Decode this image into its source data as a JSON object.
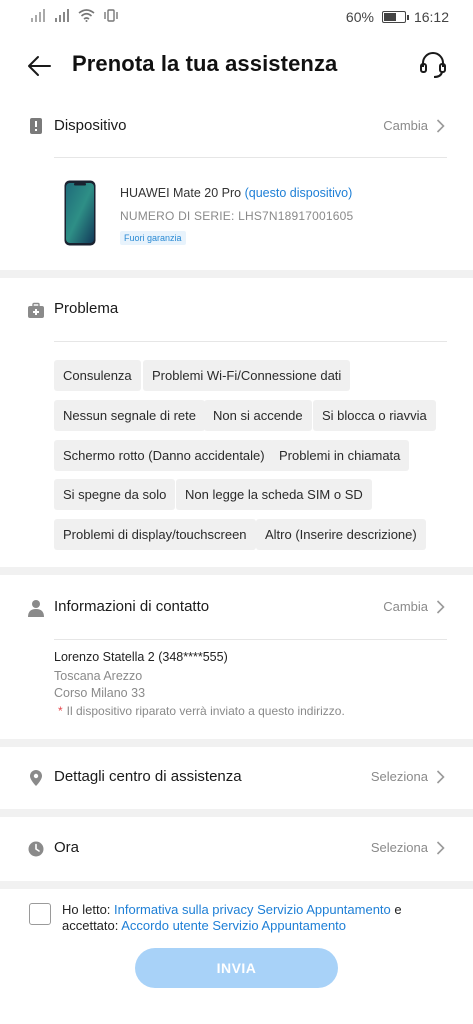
{
  "status": {
    "battery": "60%",
    "battery_level": 0.6,
    "time": "16:12"
  },
  "header": {
    "title": "Prenota la tua assistenza"
  },
  "device": {
    "title": "Dispositivo",
    "action": "Cambia",
    "name": "HUAWEI Mate 20 Pro",
    "this_device": "(questo dispositivo)",
    "serial": "NUMERO DI SERIE: LHS7N18917001605",
    "warranty": "Fuori garanzia"
  },
  "problem": {
    "title": "Problema",
    "options": [
      "Consulenza",
      "Problemi Wi-Fi/Connessione dati",
      "Nessun segnale di rete",
      "Non si accende",
      "Si blocca o riavvia",
      "Schermo rotto (Danno accidentale)",
      "Problemi in chiamata",
      "Si spegne da solo",
      "Non legge la scheda SIM o SD",
      "Problemi di display/touchscreen",
      "Altro (Inserire descrizione)"
    ]
  },
  "contact": {
    "title": "Informazioni di contatto",
    "action": "Cambia",
    "name_phone": "Lorenzo Statella 2 (348****555)",
    "region": "Toscana Arezzo",
    "street": "Corso Milano 33",
    "note": "Il dispositivo riparato verrà inviato a questo indirizzo."
  },
  "service_center": {
    "title": "Dettagli centro di assistenza",
    "action": "Seleziona"
  },
  "time_slot": {
    "title": "Ora",
    "action": "Seleziona"
  },
  "consent": {
    "prefix": "Ho letto: ",
    "privacy_link": "Informativa sulla privacy Servizio Appuntamento",
    "middle": " e accettato: ",
    "terms_link": "Accordo utente Servizio Appuntamento"
  },
  "submit": {
    "label": "INVIA"
  },
  "colors": {
    "accent": "#1e7fd6",
    "button_disabled": "#a8d2f8",
    "required": "#e5484d"
  }
}
